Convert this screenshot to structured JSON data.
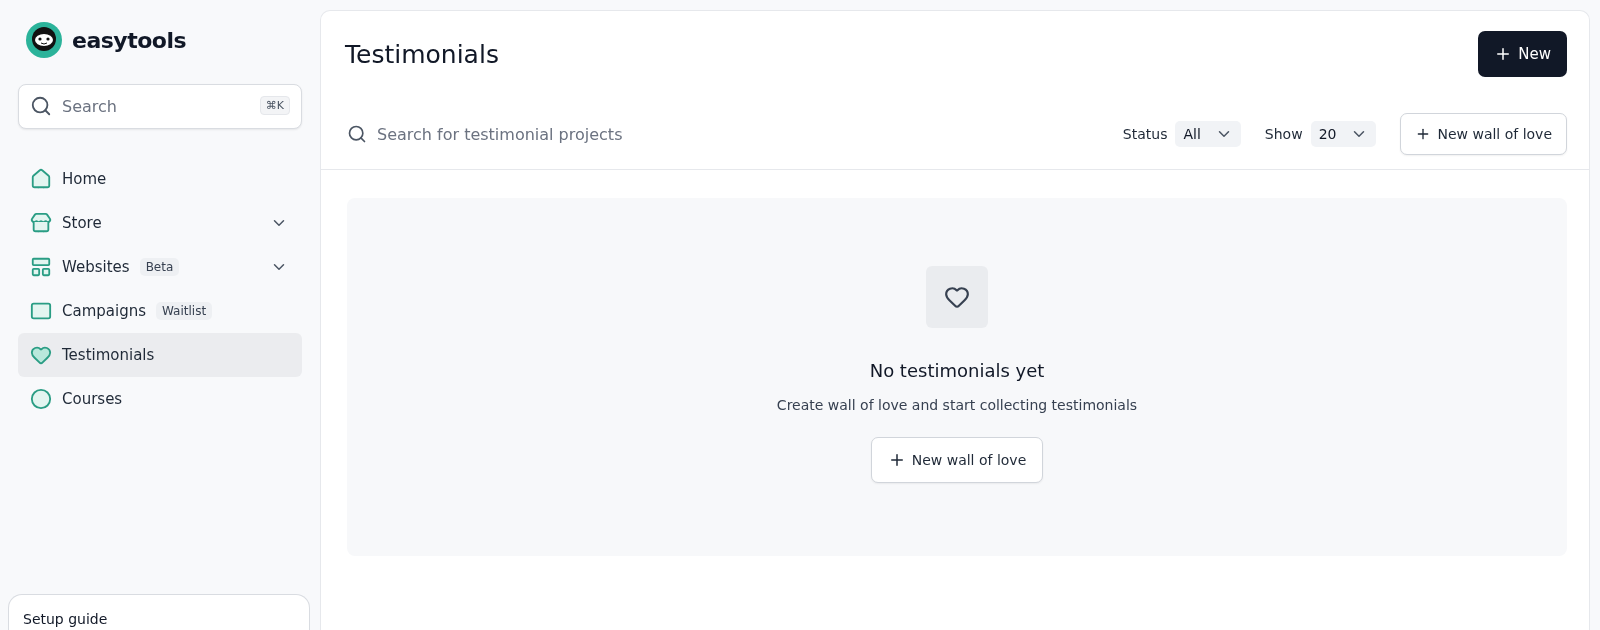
{
  "brand": {
    "name": "easytools"
  },
  "sidebar": {
    "search": {
      "placeholder": "Search",
      "shortcut": "⌘K"
    },
    "items": [
      {
        "label": "Home",
        "selected": false,
        "expandable": false
      },
      {
        "label": "Store",
        "selected": false,
        "expandable": true
      },
      {
        "label": "Websites",
        "badge": "Beta",
        "selected": false,
        "expandable": true
      },
      {
        "label": "Campaigns",
        "badge": "Waitlist",
        "selected": false,
        "expandable": false
      },
      {
        "label": "Testimonials",
        "selected": true,
        "expandable": false
      },
      {
        "label": "Courses",
        "selected": false,
        "expandable": false
      }
    ],
    "setup_guide": {
      "title": "Setup guide"
    }
  },
  "page": {
    "title": "Testimonials",
    "new_button": "New"
  },
  "toolbar": {
    "search": {
      "placeholder": "Search for testimonial projects"
    },
    "filters": [
      {
        "label": "Status",
        "value": "All"
      },
      {
        "label": "Show",
        "value": "20"
      }
    ],
    "button": "New wall of love"
  },
  "empty_state": {
    "title": "No testimonials yet",
    "text": "Create wall of love and start collecting testimonials",
    "button": "New wall of love"
  }
}
